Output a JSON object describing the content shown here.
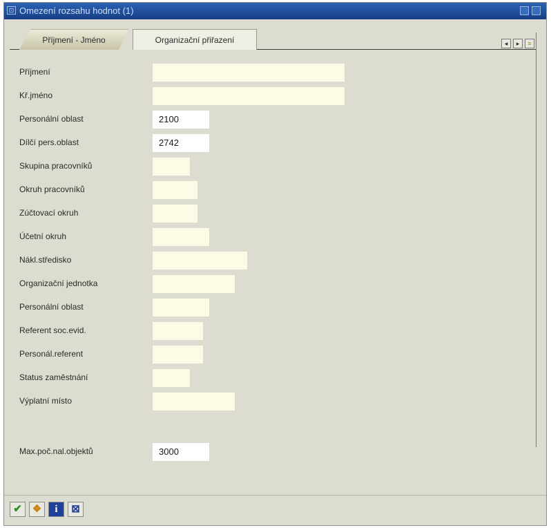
{
  "window": {
    "title": "Omezení rozsahu hodnot (1)"
  },
  "tabs": [
    {
      "label": "Příjmení - Jméno",
      "active": false
    },
    {
      "label": "Organizační přiřazení",
      "active": true
    }
  ],
  "nav_buttons": [
    "scroll-left-icon",
    "scroll-right-icon",
    "tab-list-icon"
  ],
  "fields": [
    {
      "label": "Příjmení",
      "value": ""
    },
    {
      "label": "Kř.jméno",
      "value": ""
    },
    {
      "label": "Personální oblast",
      "value": "2100"
    },
    {
      "label": "Dílčí pers.oblast",
      "value": "2742"
    },
    {
      "label": "Skupina pracovníků",
      "value": ""
    },
    {
      "label": "Okruh pracovníků",
      "value": ""
    },
    {
      "label": "Zúčtovací okruh",
      "value": ""
    },
    {
      "label": "Účetní okruh",
      "value": ""
    },
    {
      "label": "Nákl.středisko",
      "value": ""
    },
    {
      "label": "Organizační jednotka",
      "value": ""
    },
    {
      "label": "Personální oblast",
      "value": ""
    },
    {
      "label": "Referent soc.evid.",
      "value": ""
    },
    {
      "label": "Personál.referent",
      "value": ""
    },
    {
      "label": "Status zaměstnání",
      "value": ""
    },
    {
      "label": "Výplatní místo",
      "value": ""
    }
  ],
  "max_field": {
    "label": "Max.poč.nal.objektů",
    "value": "3000"
  },
  "toolbar": {
    "icons": [
      "checkmark-icon",
      "multiple-selection-icon",
      "info-icon",
      "cancel-icon"
    ],
    "colors": {
      "check": "#2e8b1e",
      "info": "#1f3f9a",
      "cancel": "#1f3f9a"
    }
  },
  "colors": {
    "titlebar": "#1e4f9e",
    "input_empty": "#fdfbe6",
    "input_filled": "#ffffff",
    "window_bg": "#dcdcd0"
  }
}
